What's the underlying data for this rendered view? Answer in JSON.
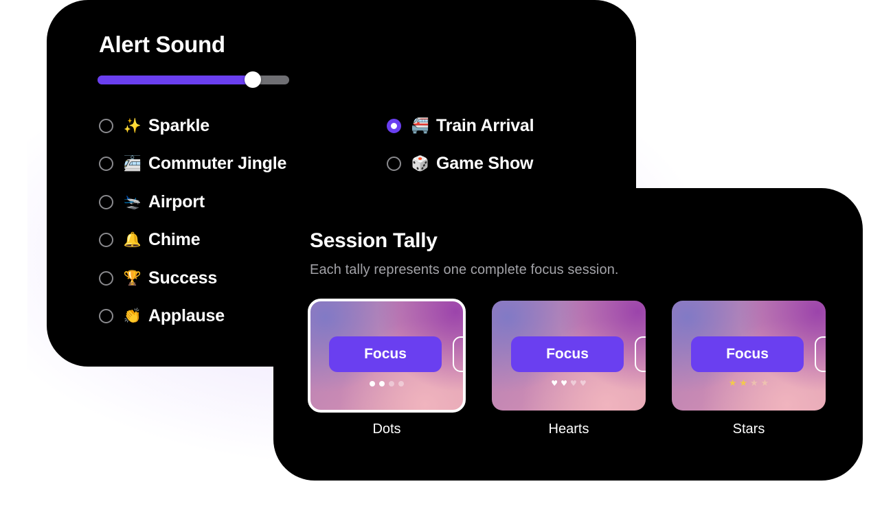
{
  "alert": {
    "title": "Alert Sound",
    "volume": 0.81,
    "accent_color": "#6a3ff0",
    "options": [
      {
        "emoji": "✨",
        "icon": "sparkles-icon",
        "label": "Sparkle",
        "selected": false
      },
      {
        "emoji": "🚈",
        "icon": "train-icon",
        "label": "Commuter Jingle",
        "selected": false
      },
      {
        "emoji": "🛬",
        "icon": "airplane-icon",
        "label": "Airport",
        "selected": false
      },
      {
        "emoji": "🔔",
        "icon": "bell-icon",
        "label": "Chime",
        "selected": false
      },
      {
        "emoji": "🏆",
        "icon": "trophy-icon",
        "label": "Success",
        "selected": false
      },
      {
        "emoji": "👏",
        "icon": "clapping-hands-icon",
        "label": "Applause",
        "selected": false
      },
      {
        "emoji": "🚝",
        "icon": "monorail-icon",
        "label": "Train Arrival",
        "selected": true
      },
      {
        "emoji": "🎲",
        "icon": "die-icon",
        "label": "Game Show",
        "selected": false
      }
    ]
  },
  "tally": {
    "title": "Session Tally",
    "subtitle": "Each tally represents one complete focus session.",
    "styles": [
      {
        "label": "Dots",
        "button": "Focus",
        "mark": "dot",
        "filled": 2,
        "total": 4,
        "selected": true
      },
      {
        "label": "Hearts",
        "button": "Focus",
        "mark": "heart",
        "filled": 2,
        "total": 4,
        "selected": false
      },
      {
        "label": "Stars",
        "button": "Focus",
        "mark": "star",
        "filled": 2,
        "total": 4,
        "selected": false
      }
    ]
  }
}
